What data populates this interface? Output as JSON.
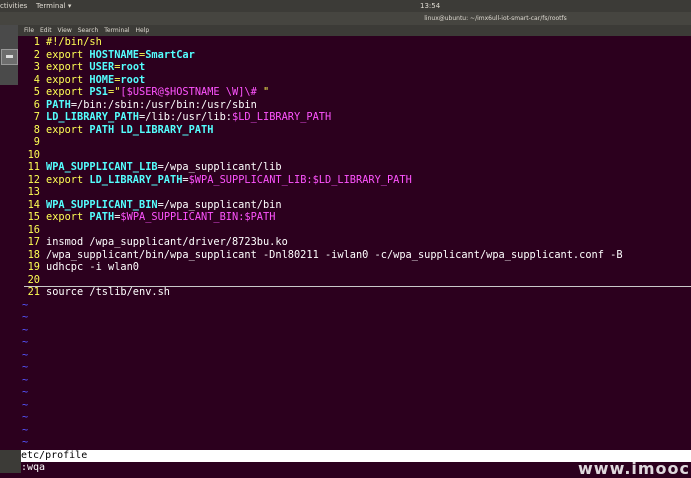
{
  "topbar": {
    "activities": "ctivities",
    "app_menu": "Terminal",
    "clock": "13:54"
  },
  "window": {
    "title": "linux@ubuntu: ~/imx6ull-iot-smart-car/fs/rootfs"
  },
  "menubar": {
    "items": [
      "File",
      "Edit",
      "View",
      "Search",
      "Terminal",
      "Help"
    ]
  },
  "editor": {
    "lines": [
      {
        "n": "1",
        "segs": [
          [
            "kw",
            "#!/bin/sh"
          ]
        ]
      },
      {
        "n": "2",
        "segs": [
          [
            "kw",
            "export "
          ],
          [
            "var",
            "HOSTNAME"
          ],
          [
            "kw",
            "="
          ],
          [
            "var",
            "SmartCar"
          ]
        ]
      },
      {
        "n": "3",
        "segs": [
          [
            "kw",
            "export "
          ],
          [
            "var",
            "USER"
          ],
          [
            "kw",
            "="
          ],
          [
            "var",
            "root"
          ]
        ]
      },
      {
        "n": "4",
        "segs": [
          [
            "kw",
            "export "
          ],
          [
            "var",
            "HOME"
          ],
          [
            "kw",
            "="
          ],
          [
            "var",
            "root"
          ]
        ]
      },
      {
        "n": "5",
        "segs": [
          [
            "kw",
            "export "
          ],
          [
            "var",
            "PS1"
          ],
          [
            "kw",
            "=\""
          ],
          [
            "str",
            "[$USER@$HOSTNAME \\W]\\# "
          ],
          [
            "kw",
            "\""
          ]
        ]
      },
      {
        "n": "6",
        "segs": [
          [
            "var",
            "PATH"
          ],
          [
            "plain",
            "=/bin:/sbin:/usr/bin:/usr/sbin"
          ]
        ]
      },
      {
        "n": "7",
        "segs": [
          [
            "var",
            "LD_LIBRARY_PATH"
          ],
          [
            "plain",
            "=/lib:/usr/lib:"
          ],
          [
            "str",
            "$LD_LIBRARY_PATH"
          ]
        ]
      },
      {
        "n": "8",
        "segs": [
          [
            "kw",
            "export "
          ],
          [
            "var",
            "PATH LD_LIBRARY_PATH"
          ]
        ]
      },
      {
        "n": "9",
        "segs": []
      },
      {
        "n": "10",
        "segs": []
      },
      {
        "n": "11",
        "segs": [
          [
            "var",
            "WPA_SUPPLICANT_LIB"
          ],
          [
            "plain",
            "=/wpa_supplicant/lib"
          ]
        ]
      },
      {
        "n": "12",
        "segs": [
          [
            "kw",
            "export "
          ],
          [
            "var",
            "LD_LIBRARY_PATH"
          ],
          [
            "plain",
            "="
          ],
          [
            "str",
            "$WPA_SUPPLICANT_LIB:$LD_LIBRARY_PATH"
          ]
        ]
      },
      {
        "n": "13",
        "segs": []
      },
      {
        "n": "14",
        "segs": [
          [
            "var",
            "WPA_SUPPLICANT_BIN"
          ],
          [
            "plain",
            "=/wpa_supplicant/bin"
          ]
        ]
      },
      {
        "n": "15",
        "segs": [
          [
            "kw",
            "export "
          ],
          [
            "var",
            "PATH"
          ],
          [
            "plain",
            "="
          ],
          [
            "str",
            "$WPA_SUPPLICANT_BIN:$PATH"
          ]
        ]
      },
      {
        "n": "16",
        "segs": []
      },
      {
        "n": "17",
        "segs": [
          [
            "plain",
            "insmod /wpa_supplicant/driver/8723bu.ko"
          ]
        ]
      },
      {
        "n": "18",
        "segs": [
          [
            "plain",
            "/wpa_supplicant/bin/wpa_supplicant -Dnl80211 -iwlan0 -c/wpa_supplicant/wpa_supplicant.conf -B"
          ]
        ]
      },
      {
        "n": "19",
        "segs": [
          [
            "plain",
            "udhcpc -i wlan0"
          ]
        ]
      },
      {
        "n": "20",
        "segs": []
      },
      {
        "n": "21",
        "segs": [
          [
            "plain",
            "source /tslib/env.sh"
          ]
        ]
      }
    ],
    "tilde_count": 12,
    "tilde_char": "~"
  },
  "statusline": "etc/profile",
  "cmdline": ":wqa",
  "watermark": "www.imooc"
}
